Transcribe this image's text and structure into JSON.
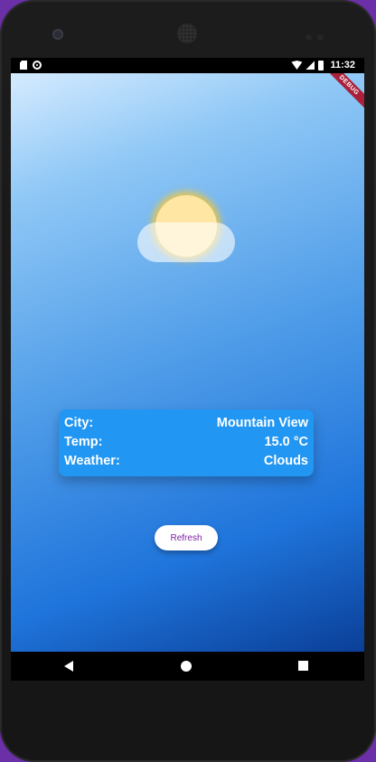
{
  "status_bar": {
    "time": "11:32"
  },
  "debug_banner": "DEBUG",
  "weather_card": {
    "rows": [
      {
        "label": "City:",
        "value": "Mountain View"
      },
      {
        "label": "Temp:",
        "value": "15.0 °C"
      },
      {
        "label": "Weather:",
        "value": "Clouds"
      }
    ]
  },
  "refresh_button": {
    "label": "Refresh"
  },
  "icons": {
    "weather_icon": "sun-behind-cloud-icon",
    "status_left": [
      "sd-card-icon",
      "record-icon"
    ],
    "status_right": [
      "wifi-icon",
      "signal-icon",
      "battery-icon"
    ],
    "nav": [
      "back-icon",
      "home-icon",
      "recents-icon"
    ]
  },
  "colors": {
    "card_background": "#2196f3",
    "button_text": "#7b1fa2",
    "sun": "#ffe7a3"
  }
}
